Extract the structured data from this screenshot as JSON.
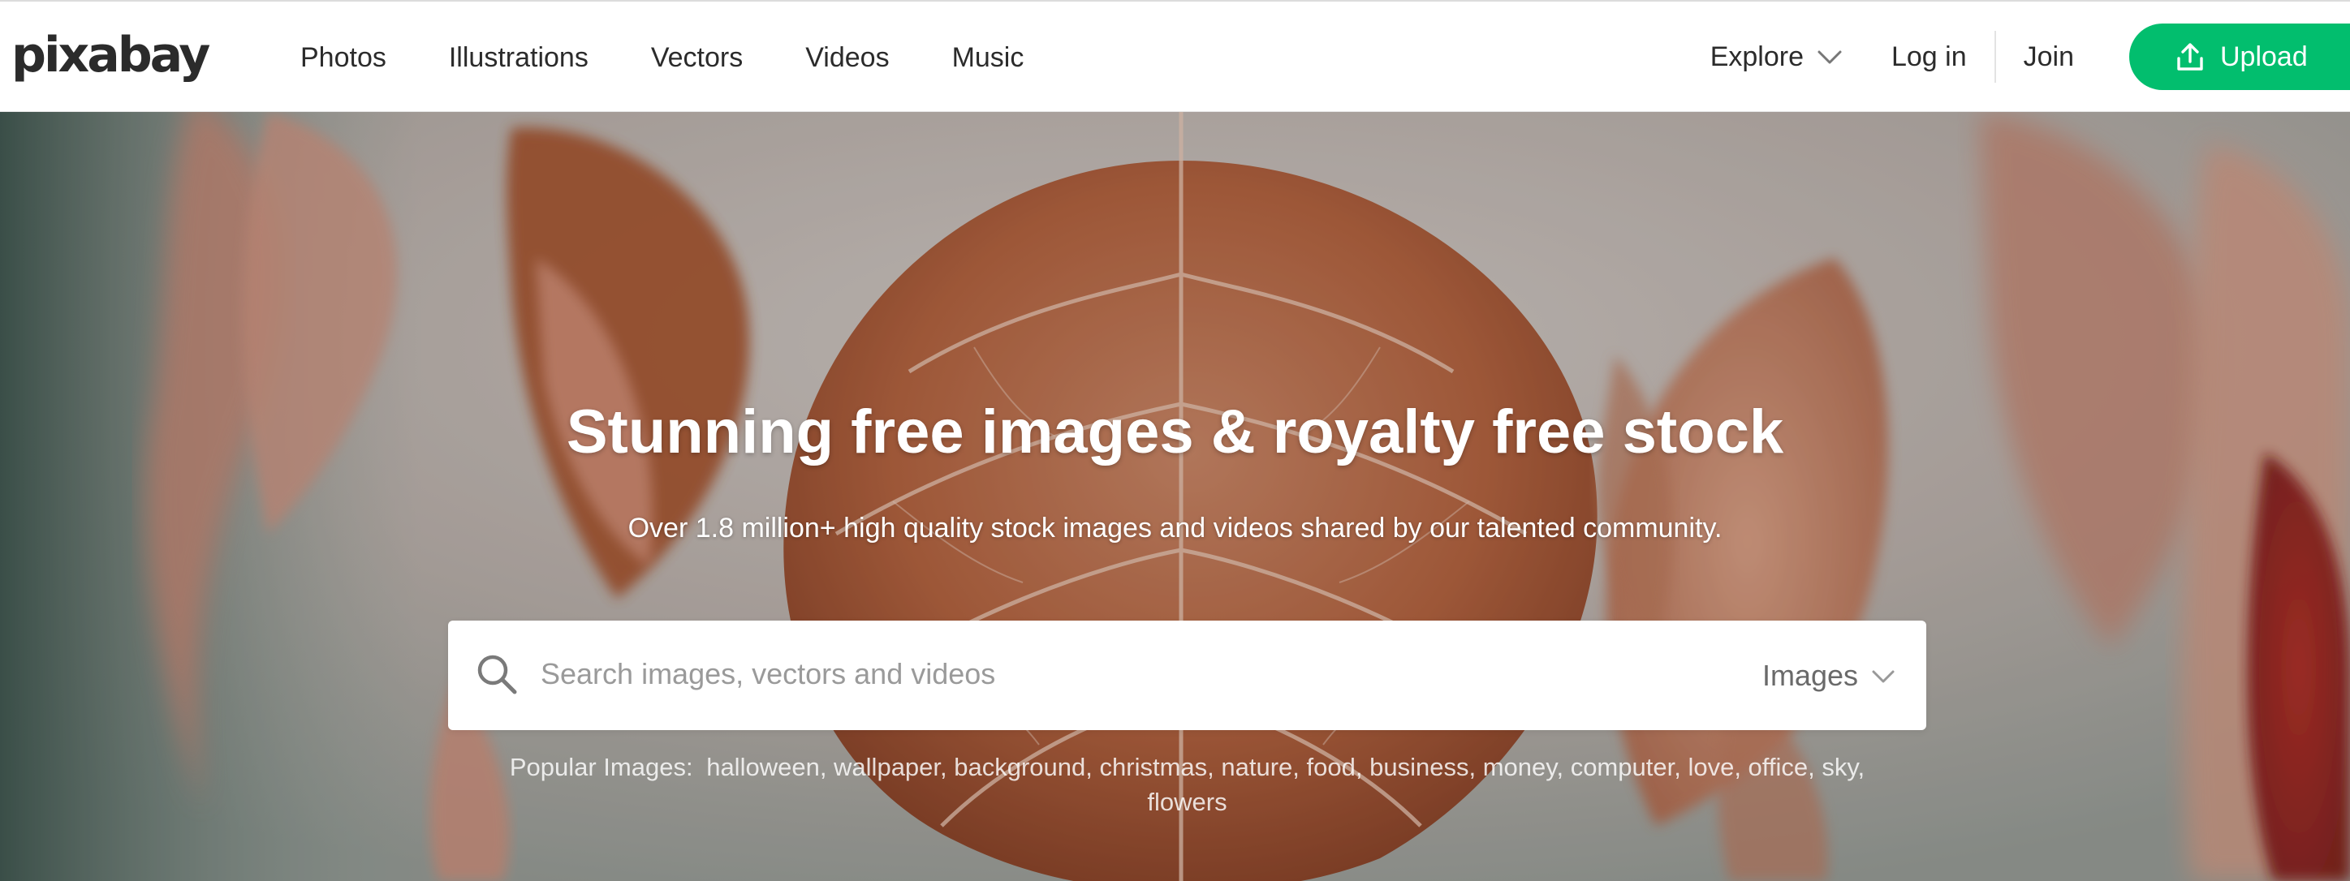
{
  "header": {
    "logo": "pixabay",
    "nav": [
      {
        "label": "Photos"
      },
      {
        "label": "Illustrations"
      },
      {
        "label": "Vectors"
      },
      {
        "label": "Videos"
      },
      {
        "label": "Music"
      }
    ],
    "explore_label": "Explore",
    "login_label": "Log in",
    "join_label": "Join",
    "upload_label": "Upload"
  },
  "hero": {
    "title": "Stunning free images & royalty free stock",
    "subtitle": "Over 1.8 million+ high quality stock images and videos shared by our talented community."
  },
  "search": {
    "placeholder": "Search images, vectors and videos",
    "value": "",
    "type_selected": "Images"
  },
  "popular": {
    "label": "Popular Images:",
    "tags": [
      "halloween",
      "wallpaper",
      "background",
      "christmas",
      "nature",
      "food",
      "business",
      "money",
      "computer",
      "love",
      "office",
      "sky",
      "flowers"
    ]
  },
  "colors": {
    "accent": "#02be6e",
    "text": "#2b2b2b"
  },
  "icons": {
    "upload": "upload-icon",
    "search": "search-icon",
    "explore_chevron": "chevron-down-icon",
    "type_chevron": "chevron-down-icon"
  }
}
